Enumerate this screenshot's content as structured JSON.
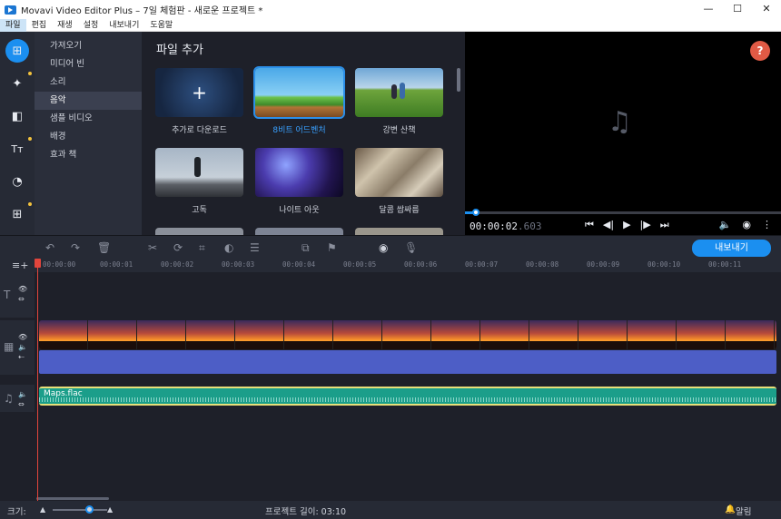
{
  "window": {
    "title": "Movavi Video Editor Plus – 7일 체험판 - 새로운 프로젝트 *",
    "minimize": "—",
    "maximize": "☐",
    "close": "✕"
  },
  "menu": [
    "파일",
    "편집",
    "재생",
    "설정",
    "내보내기",
    "도움말"
  ],
  "tools": [
    {
      "name": "import-icon",
      "glyph": "⊞"
    },
    {
      "name": "magic-wand-icon",
      "glyph": "✦"
    },
    {
      "name": "transitions-icon",
      "glyph": "◧"
    },
    {
      "name": "titles-icon",
      "glyph": "Tт"
    },
    {
      "name": "stickers-icon",
      "glyph": "◔"
    },
    {
      "name": "more-tools-icon",
      "glyph": "⊞"
    }
  ],
  "categories": [
    "가져오기",
    "미디어 빈",
    "소리",
    "음악",
    "샘플 비디오",
    "배경",
    "효과 책"
  ],
  "active_category": "음악",
  "media": {
    "title": "파일 추가",
    "tiles": [
      {
        "label": "추가로 다운로드",
        "plus": "+"
      },
      {
        "label": "8비트 어드벤처"
      },
      {
        "label": "강변 산책"
      },
      {
        "label": "고독"
      },
      {
        "label": "나이트 아웃"
      },
      {
        "label": "달콤 쌉싸름"
      }
    ]
  },
  "player": {
    "help": "?",
    "note_icon": "♫",
    "timecode_main": "00:00:02",
    "timecode_frac": ".603",
    "progress": 0.034
  },
  "toolbar": {
    "export_label": "내보내기"
  },
  "ruler": [
    "00:00:00",
    "00:00:01",
    "00:00:02",
    "00:00:03",
    "00:00:04",
    "00:00:05",
    "00:00:06",
    "00:00:07",
    "00:00:08",
    "00:00:09",
    "00:00:10",
    "00:00:11"
  ],
  "audio_clip": {
    "name": "Maps.flac"
  },
  "status": {
    "zoom_label": "크기:",
    "project_length": "프로젝트 길이: 03:10",
    "notifications": "알림"
  },
  "colors": {
    "accent": "#1b8ff0",
    "audio_clip": "#1b9e8a",
    "video_audio": "#4d5ec6",
    "help": "#e05a45",
    "playhead": "#e2453c"
  }
}
